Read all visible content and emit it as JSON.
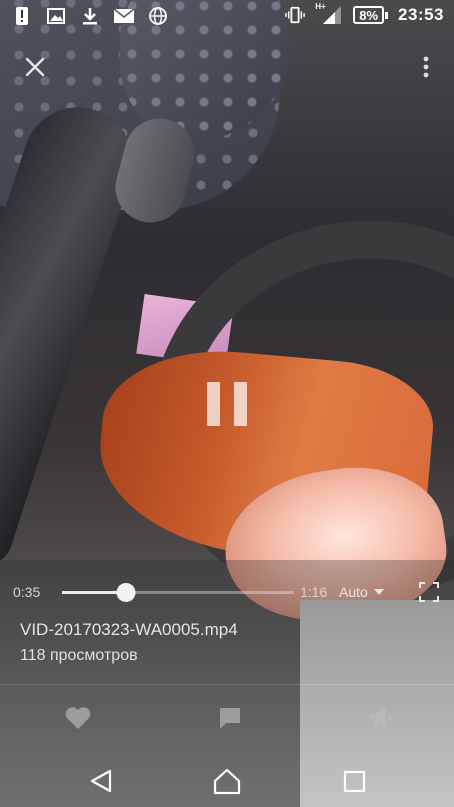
{
  "status_bar": {
    "battery_percent": "8%",
    "time": "23:53",
    "network_label": "H+",
    "icons": [
      "alert-icon",
      "image-icon",
      "download-icon",
      "mail-icon",
      "globe-icon",
      "vibrate-icon",
      "signal-icon",
      "battery-icon"
    ]
  },
  "player": {
    "current_time": "0:35",
    "duration": "1:16",
    "progress_fraction": 0.277,
    "quality_label": "Auto",
    "state": "playing"
  },
  "video_info": {
    "filename": "VID-20170323-WA0005.mp4",
    "views": "118 просмотров"
  },
  "actions": [
    "like-icon",
    "comment-icon",
    "share-icon"
  ],
  "navigation": [
    "back-icon",
    "home-icon",
    "recents-icon"
  ]
}
